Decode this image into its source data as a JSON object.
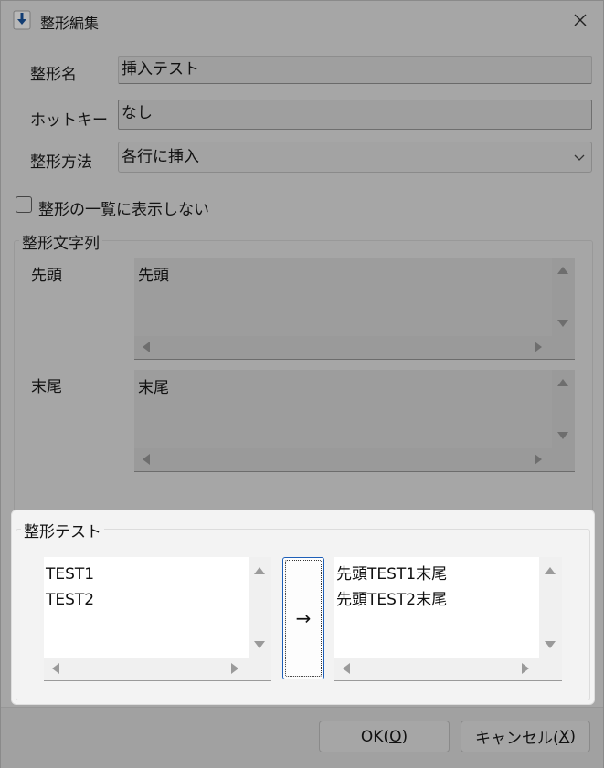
{
  "window": {
    "title": "整形編集",
    "close_glyph": "✕"
  },
  "form": {
    "name_label": "整形名",
    "name_value": "挿入テスト",
    "hotkey_label": "ホットキー",
    "hotkey_value": "なし",
    "method_label": "整形方法",
    "method_value": "各行に挿入",
    "hide_checkbox_label": "整形の一覧に表示しない",
    "hide_checkbox_checked": false
  },
  "format_strings": {
    "group_title": "整形文字列",
    "head_label": "先頭",
    "head_value": "先頭",
    "tail_label": "末尾",
    "tail_value": "末尾"
  },
  "test": {
    "group_title": "整形テスト",
    "input_text": "TEST1\nTEST2",
    "convert_button": "→",
    "output_text": "先頭TEST1末尾\n先頭TEST2末尾"
  },
  "buttons": {
    "ok_text": "OK(",
    "ok_key": "O",
    "ok_end": ")",
    "cancel_text": "キャンセル(",
    "cancel_key": "X",
    "cancel_end": ")"
  },
  "colors": {
    "accent": "#1e5fb8",
    "dimmed_background": "#a6a6a6",
    "test_panel_background": "#f3f3f3"
  },
  "icons": {
    "title": "download-arrow-icon",
    "close": "close-icon",
    "dropdown": "chevron-down-icon"
  }
}
